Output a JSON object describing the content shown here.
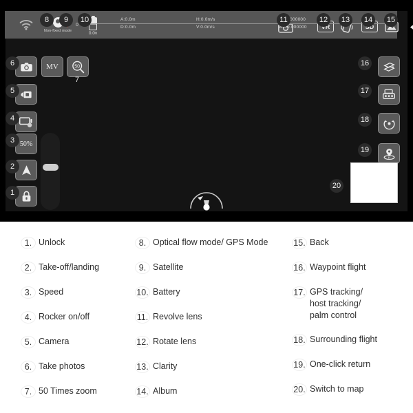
{
  "app": {
    "status_bar": {
      "wifi_icon": "wifi-icon",
      "flight_mode": {
        "icon": "gps-mode-icon",
        "label": "Non-fixed mode"
      },
      "satellite": {
        "icon": "satellite-icon",
        "count": "0",
        "color": "#d94a3a"
      },
      "battery": {
        "icon": "battery-icon",
        "voltage": "0.0v"
      },
      "telemetry": [
        {
          "line1": "A:0.0m",
          "line2": "D:0.0m"
        },
        {
          "line1": "H:0.0m/s",
          "line2": "V:0.0m/s"
        },
        {
          "line1": "S:00.000000",
          "line2": "W:00.000000"
        }
      ],
      "right_icons": [
        {
          "name": "revolve-lens-icon",
          "label": "VR_none_1"
        },
        {
          "name": "vr-icon",
          "label": "VR"
        },
        {
          "name": "rotate-lens-icon",
          "label": ""
        },
        {
          "name": "sd-clarity-icon",
          "label": "SD"
        },
        {
          "name": "album-icon",
          "label": ""
        },
        {
          "name": "back-arrow-icon",
          "label": ""
        }
      ]
    },
    "left_controls": [
      {
        "num": "6",
        "name": "take-photos-button",
        "glyph": "camera-icon"
      },
      {
        "num": "",
        "name": "mv-button",
        "glyph": "MV"
      },
      {
        "num": "7",
        "name": "zoom-50x-button",
        "glyph": "magnifier-50-icon"
      },
      {
        "num": "5",
        "name": "camera-button",
        "glyph": "video-camera-icon"
      },
      {
        "num": "4",
        "name": "rocker-on-off-button",
        "glyph": "rocker-icon"
      },
      {
        "num": "3",
        "name": "speed-button",
        "glyph": "50%"
      },
      {
        "num": "2",
        "name": "takeoff-landing-button",
        "glyph": "arrow-up-icon"
      },
      {
        "num": "1",
        "name": "unlock-button",
        "glyph": "lock-icon"
      }
    ],
    "right_controls": [
      {
        "num": "16",
        "name": "waypoint-flight-button",
        "glyph": "waypoint-icon"
      },
      {
        "num": "17",
        "name": "gps-tracking-button",
        "glyph": "remote-controller-icon"
      },
      {
        "num": "18",
        "name": "surrounding-flight-button",
        "glyph": "orbit-icon"
      },
      {
        "num": "19",
        "name": "one-click-return-button",
        "glyph": "return-home-icon"
      },
      {
        "num": "20",
        "name": "switch-to-map-thumbnail",
        "glyph": "map-thumbnail"
      }
    ],
    "top_badges": [
      "8",
      "9",
      "10",
      "11",
      "12",
      "13",
      "14",
      "15"
    ],
    "speed_value": "50%",
    "mv_label": "MV",
    "zoom_label": "50",
    "zoom_number": "7",
    "vr_label": "VR",
    "sd_label": "SD"
  },
  "legend": {
    "columns": [
      [
        {
          "num": "1.",
          "text": "Unlock"
        },
        {
          "num": "2.",
          "text": "Take-off/landing"
        },
        {
          "num": "3.",
          "text": "Speed"
        },
        {
          "num": "4.",
          "text": "Rocker on/off"
        },
        {
          "num": "5.",
          "text": "Camera"
        },
        {
          "num": "6.",
          "text": "Take photos"
        },
        {
          "num": "7.",
          "text": "50 Times zoom"
        }
      ],
      [
        {
          "num": "8.",
          "text": "Optical flow mode/ GPS Mode"
        },
        {
          "num": "9.",
          "text": "Satellite"
        },
        {
          "num": "10.",
          "text": "Battery"
        },
        {
          "num": "11.",
          "text": "Revolve lens"
        },
        {
          "num": "12.",
          "text": "Rotate lens"
        },
        {
          "num": "13.",
          "text": "Clarity"
        },
        {
          "num": "14.",
          "text": "Album"
        }
      ],
      [
        {
          "num": "15.",
          "text": "Back"
        },
        {
          "num": "16.",
          "text": "Waypoint flight"
        },
        {
          "num": "17.",
          "text": "GPS tracking/\nhost tracking/\npalm control"
        },
        {
          "num": "18.",
          "text": "Surrounding flight"
        },
        {
          "num": "19.",
          "text": "One-click return"
        },
        {
          "num": "20.",
          "text": "Switch to map"
        }
      ]
    ]
  },
  "colors": {
    "frame": "#000000",
    "screen": "#141414",
    "toolbar": "#565656",
    "button": "#5a5a5a",
    "button_border": "#8d8d8d",
    "badge": "#2b2b2b",
    "text_light": "#ececec",
    "legend_text": "#2f2f2f"
  }
}
